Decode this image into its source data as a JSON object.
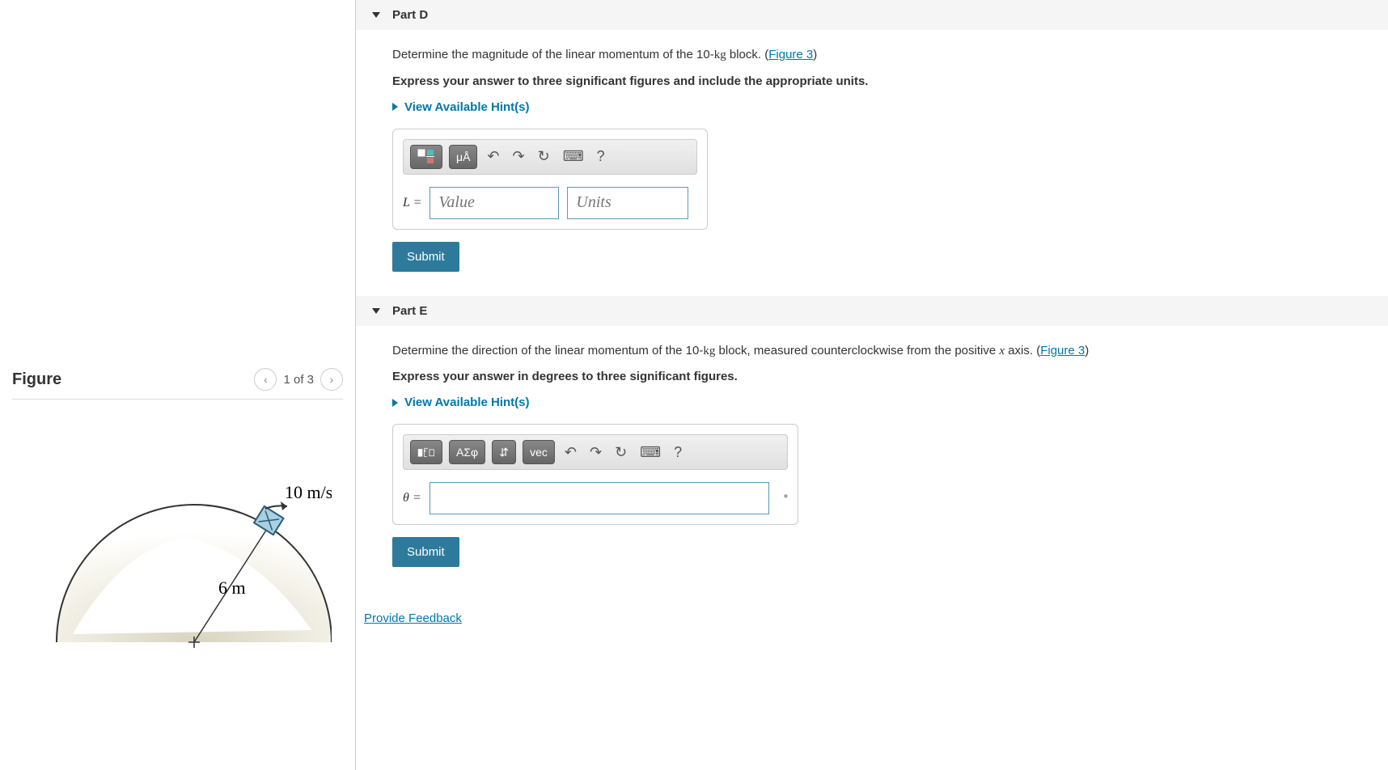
{
  "figure": {
    "title": "Figure",
    "counter": "1 of 3",
    "velocity_label": "10 m/s",
    "radius_label": "6 m"
  },
  "partD": {
    "title": "Part D",
    "prompt_pre": "Determine the magnitude of the linear momentum of the 10-",
    "prompt_unit": "kg",
    "prompt_post": " block. (",
    "figure_link": "Figure 3",
    "prompt_close": ")",
    "instruction": "Express your answer to three significant figures and include the appropriate units.",
    "hints_label": "View Available Hint(s)",
    "toolbar": {
      "mu": "μÅ",
      "help": "?"
    },
    "var_label": "L =",
    "value_placeholder": "Value",
    "units_placeholder": "Units",
    "submit": "Submit"
  },
  "partE": {
    "title": "Part E",
    "prompt_pre": "Determine the direction of the linear momentum of the 10-",
    "prompt_unit": "kg",
    "prompt_mid": " block, measured counterclockwise from the positive ",
    "axis": "x",
    "prompt_post": " axis. (",
    "figure_link": "Figure 3",
    "prompt_close": ")",
    "instruction": "Express your answer in degrees to three significant figures.",
    "hints_label": "View Available Hint(s)",
    "toolbar": {
      "greek": "ΑΣφ",
      "vec": "vec",
      "help": "?"
    },
    "var_label": "θ =",
    "degree": "°",
    "submit": "Submit"
  },
  "feedback": "Provide Feedback"
}
